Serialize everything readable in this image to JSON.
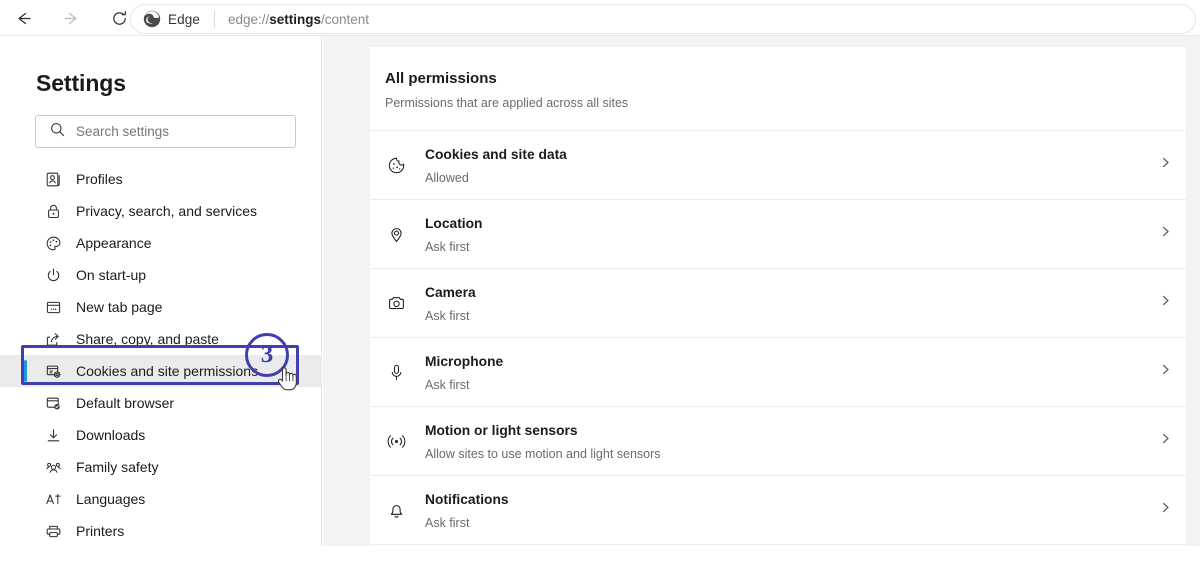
{
  "browser": {
    "back_icon": "back-arrow-icon",
    "forward_icon": "forward-arrow-icon",
    "reload_icon": "reload-icon",
    "brand_label": "Edge",
    "url_prefix": "edge://",
    "url_bold": "settings",
    "url_suffix": "/content"
  },
  "sidebar": {
    "title": "Settings",
    "search": {
      "placeholder": "Search settings",
      "value": "",
      "icon": "search-icon"
    },
    "accent_color": "#1a9ae0",
    "items": [
      {
        "label": "Profiles",
        "icon": "profile-icon",
        "selected": false
      },
      {
        "label": "Privacy, search, and services",
        "icon": "lock-icon",
        "selected": false
      },
      {
        "label": "Appearance",
        "icon": "palette-icon",
        "selected": false
      },
      {
        "label": "On start-up",
        "icon": "power-icon",
        "selected": false
      },
      {
        "label": "New tab page",
        "icon": "new-tab-icon",
        "selected": false
      },
      {
        "label": "Share, copy, and paste",
        "icon": "share-icon",
        "selected": false
      },
      {
        "label": "Cookies and site permissions",
        "icon": "cookies-permissions-icon",
        "selected": true
      },
      {
        "label": "Default browser",
        "icon": "default-browser-icon",
        "selected": false
      },
      {
        "label": "Downloads",
        "icon": "download-icon",
        "selected": false
      },
      {
        "label": "Family safety",
        "icon": "family-icon",
        "selected": false
      },
      {
        "label": "Languages",
        "icon": "languages-icon",
        "selected": false
      },
      {
        "label": "Printers",
        "icon": "printer-icon",
        "selected": false
      }
    ]
  },
  "annotation": {
    "step_number": "3",
    "color": "#3f3fb0"
  },
  "content": {
    "heading": "All permissions",
    "subheading": "Permissions that are applied across all sites",
    "permissions": [
      {
        "title": "Cookies and site data",
        "status": "Allowed",
        "icon": "cookie-icon",
        "chevron": "chevron-right-icon"
      },
      {
        "title": "Location",
        "status": "Ask first",
        "icon": "location-pin-icon",
        "chevron": "chevron-right-icon"
      },
      {
        "title": "Camera",
        "status": "Ask first",
        "icon": "camera-icon",
        "chevron": "chevron-right-icon"
      },
      {
        "title": "Microphone",
        "status": "Ask first",
        "icon": "microphone-icon",
        "chevron": "chevron-right-icon"
      },
      {
        "title": "Motion or light sensors",
        "status": "Allow sites to use motion and light sensors",
        "icon": "motion-sensor-icon",
        "chevron": "chevron-right-icon"
      },
      {
        "title": "Notifications",
        "status": "Ask first",
        "icon": "bell-icon",
        "chevron": "chevron-right-icon"
      }
    ]
  }
}
